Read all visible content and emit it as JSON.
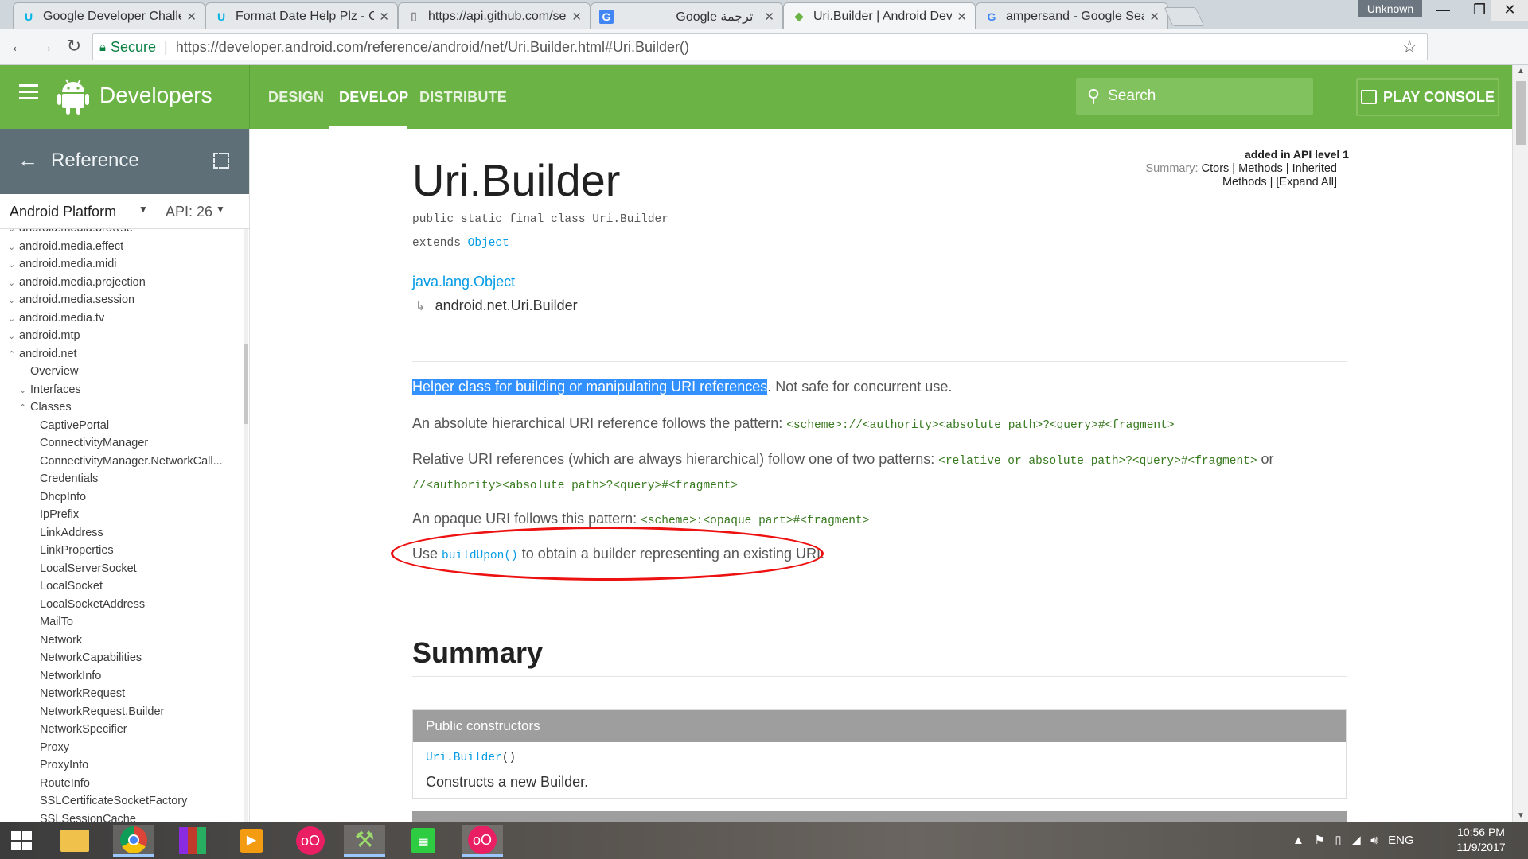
{
  "browser": {
    "tabs": [
      {
        "title": "Google Developer Challe",
        "icon": "udacity-icon",
        "color": "#02b3e4"
      },
      {
        "title": "Format Date Help Plz - C",
        "icon": "udacity-icon",
        "color": "#02b3e4"
      },
      {
        "title": "https://api.github.com/se",
        "icon": "page-icon",
        "color": "#888888"
      },
      {
        "title": "Google ترجمة",
        "icon": "translate-icon",
        "color": "#4285f4"
      },
      {
        "title": "Uri.Builder | Android Dev",
        "icon": "android-icon",
        "color": "#6ab344",
        "active": true
      },
      {
        "title": "ampersand - Google Sea",
        "icon": "google-icon",
        "color": "#4285f4"
      }
    ],
    "profile_label": "Unknown",
    "secure_label": "Secure",
    "url": "https://developer.android.com/reference/android/net/Uri.Builder.html#Uri.Builder()"
  },
  "header": {
    "brand": "Developers",
    "nav": [
      "DESIGN",
      "DEVELOP",
      "DISTRIBUTE"
    ],
    "active_nav": "DEVELOP",
    "search_placeholder": "Search",
    "play_console": "PLAY CONSOLE",
    "brand_color": "#6ab344"
  },
  "sidebar": {
    "title": "Reference",
    "platform": "Android Platform",
    "api": "API: 26",
    "items": [
      {
        "label": "android.media.browse",
        "chev": "v",
        "indent": 0
      },
      {
        "label": "android.media.effect",
        "chev": "v",
        "indent": 0
      },
      {
        "label": "android.media.midi",
        "chev": "v",
        "indent": 0
      },
      {
        "label": "android.media.projection",
        "chev": "v",
        "indent": 0
      },
      {
        "label": "android.media.session",
        "chev": "v",
        "indent": 0
      },
      {
        "label": "android.media.tv",
        "chev": "v",
        "indent": 0
      },
      {
        "label": "android.mtp",
        "chev": "v",
        "indent": 0
      },
      {
        "label": "android.net",
        "chev": "^",
        "indent": 0
      },
      {
        "label": "Overview",
        "chev": "",
        "indent": 1
      },
      {
        "label": "Interfaces",
        "chev": "v",
        "indent": 1
      },
      {
        "label": "Classes",
        "chev": "^",
        "indent": 1
      },
      {
        "label": "CaptivePortal",
        "chev": "",
        "indent": 2
      },
      {
        "label": "ConnectivityManager",
        "chev": "",
        "indent": 2
      },
      {
        "label": "ConnectivityManager.NetworkCall...",
        "chev": "",
        "indent": 2
      },
      {
        "label": "Credentials",
        "chev": "",
        "indent": 2
      },
      {
        "label": "DhcpInfo",
        "chev": "",
        "indent": 2
      },
      {
        "label": "IpPrefix",
        "chev": "",
        "indent": 2
      },
      {
        "label": "LinkAddress",
        "chev": "",
        "indent": 2
      },
      {
        "label": "LinkProperties",
        "chev": "",
        "indent": 2
      },
      {
        "label": "LocalServerSocket",
        "chev": "",
        "indent": 2
      },
      {
        "label": "LocalSocket",
        "chev": "",
        "indent": 2
      },
      {
        "label": "LocalSocketAddress",
        "chev": "",
        "indent": 2
      },
      {
        "label": "MailTo",
        "chev": "",
        "indent": 2
      },
      {
        "label": "Network",
        "chev": "",
        "indent": 2
      },
      {
        "label": "NetworkCapabilities",
        "chev": "",
        "indent": 2
      },
      {
        "label": "NetworkInfo",
        "chev": "",
        "indent": 2
      },
      {
        "label": "NetworkRequest",
        "chev": "",
        "indent": 2
      },
      {
        "label": "NetworkRequest.Builder",
        "chev": "",
        "indent": 2
      },
      {
        "label": "NetworkSpecifier",
        "chev": "",
        "indent": 2
      },
      {
        "label": "Proxy",
        "chev": "",
        "indent": 2
      },
      {
        "label": "ProxyInfo",
        "chev": "",
        "indent": 2
      },
      {
        "label": "RouteInfo",
        "chev": "",
        "indent": 2
      },
      {
        "label": "SSLCertificateSocketFactory",
        "chev": "",
        "indent": 2
      },
      {
        "label": "SSLSessionCache",
        "chev": "",
        "indent": 2
      }
    ]
  },
  "content": {
    "title": "Uri.Builder",
    "added": "added in API level 1",
    "summary_label": "Summary:",
    "summary_links": [
      "Ctors",
      "Methods",
      "Inherited Methods",
      "[Expand All]"
    ],
    "sig_line1": "public static final class Uri.Builder",
    "sig_extends": "extends",
    "sig_object": "Object",
    "inherit_parent": "java.lang.Object",
    "inherit_child": "android.net.Uri.Builder",
    "p1_highlight": "Helper class for building or manipulating URI references",
    "p1_rest": ". Not safe for concurrent use.",
    "p2_text": "An absolute hierarchical URI reference follows the pattern: ",
    "p2_code": "<scheme>://<authority><absolute path>?<query>#<fragment>",
    "p3_text": "Relative URI references (which are always hierarchical) follow one of two patterns: ",
    "p3_code1": "<relative or absolute path>?<query>#<fragment>",
    "p3_or": " or",
    "p3_code2": "//<authority><absolute path>?<query>#<fragment>",
    "p4_text": "An opaque URI follows this pattern: ",
    "p4_code": "<scheme>:<opaque part>#<fragment>",
    "p5_pre": "Use ",
    "p5_link": "buildUpon()",
    "p5_post": " to obtain a builder representing an existing URI.",
    "annotation_color": "#ee1111",
    "summary_heading": "Summary",
    "ctor_table_header": "Public constructors",
    "ctor_name": "Uri.Builder",
    "ctor_parens": "()",
    "ctor_desc": "Constructs a new Builder."
  },
  "taskbar": {
    "apps": [
      "windows-start-icon",
      "file-explorer-icon",
      "chrome-icon",
      "winrar-icon",
      "media-player-icon",
      "flickr-icon",
      "android-studio-icon",
      "store-icon",
      "flickr-icon"
    ],
    "lang": "ENG",
    "time": "10:56 PM",
    "date": "11/9/2017"
  }
}
